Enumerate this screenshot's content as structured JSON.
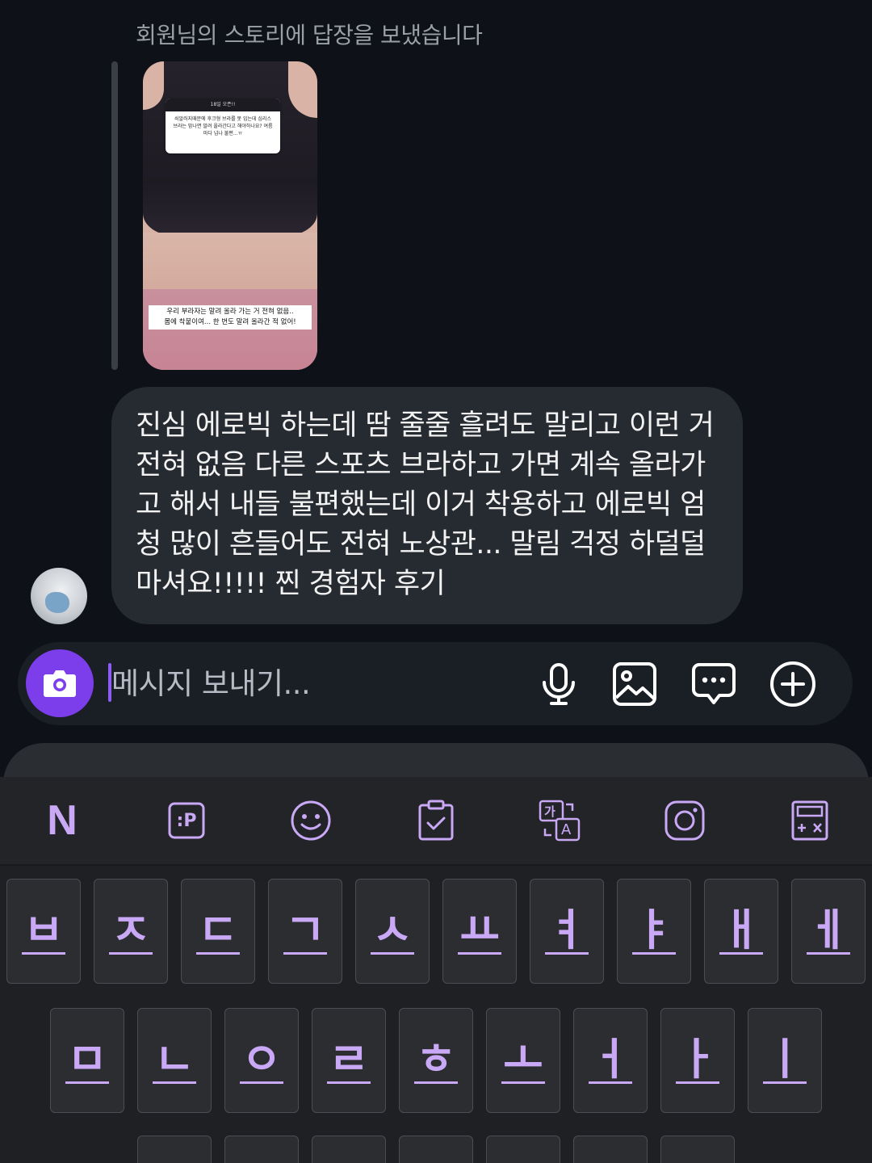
{
  "thread": {
    "reply_note": "회원님의 스토리에 답장을 보냈습니다",
    "story": {
      "header": "18일 오픈!!",
      "question": "쇠알러지때문에 후크형 브라를 못 입는데 심리스 브라는 맘나면 말려 올라간다고 해야하나요? 여름마다 넘나 불편...ㅠ",
      "caption_line1": "우리 부라자는 말려 올라 가는 거 전혀 없음..",
      "caption_line2": "몸에 착붙이여... 한 번도 말려 올라간 적 없어!"
    },
    "message": "진심 에로빅 하는데 땀 줄줄 흘려도 말리고 이런 거 전혀 없음 다른 스포츠 브라하고 가면 계속 올라가고 해서 내들 불편했는데 이거 착용하고 에로빅 엄청 많이 흔들어도 전혀 노상관... 말림 걱정 하덜덜 마셔요!!!!! 찐 경험자 후기"
  },
  "composer": {
    "placeholder": "메시지 보내기...",
    "icons": [
      "camera-icon",
      "microphone-icon",
      "image-icon",
      "message-icon",
      "plus-icon"
    ],
    "camera_color": "#7c3dea"
  },
  "keyboard": {
    "toolbar_icons": [
      "naver-icon",
      "clipboard-p-icon",
      "emoji-icon",
      "clipboard-check-icon",
      "translate-icon",
      "instagram-icon",
      "calculator-icon"
    ],
    "toolbar_labels": {
      "naver": "N",
      "p": ":P",
      "translate_ko": "가",
      "translate_en": "A"
    },
    "row1": [
      "ㅂ",
      "ㅈ",
      "ㄷ",
      "ㄱ",
      "ㅅ",
      "ㅛ",
      "ㅕ",
      "ㅑ",
      "ㅐ",
      "ㅔ"
    ],
    "row2": [
      "ㅁ",
      "ㄴ",
      "ㅇ",
      "ㄹ",
      "ㅎ",
      "ㅗ",
      "ㅓ",
      "ㅏ",
      "ㅣ"
    ],
    "accent": "#c9a8f5"
  }
}
